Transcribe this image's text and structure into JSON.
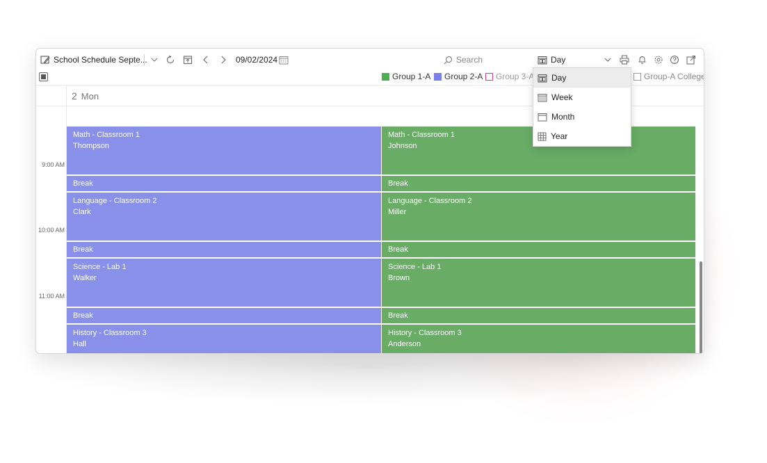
{
  "toolbar": {
    "title": "School Schedule Septe...",
    "date": "09/02/2024",
    "search_placeholder": "Search",
    "view_selected": "Day"
  },
  "legend": [
    {
      "label": "Group 1-A",
      "color": "#4caf50",
      "filled": true
    },
    {
      "label": "Group 2-A",
      "color": "#7b80e8",
      "filled": true
    },
    {
      "label": "Group 3-A",
      "color": "#e0407a",
      "filled": false
    },
    {
      "label": "Group-A College",
      "color": "#66cc44",
      "filled": false
    }
  ],
  "day_header": {
    "num": "2",
    "weekday": "Mon"
  },
  "time_labels": [
    "9:00 AM",
    "10:00 AM",
    "11:00 AM"
  ],
  "columns": [
    {
      "color": "#8890ea",
      "events": [
        {
          "title": "Math - Classroom 1",
          "teacher": "Thompson"
        },
        {
          "title": "Break",
          "teacher": ""
        },
        {
          "title": "Language - Classroom 2",
          "teacher": "Clark"
        },
        {
          "title": "Break",
          "teacher": ""
        },
        {
          "title": "Science - Lab 1",
          "teacher": "Walker"
        },
        {
          "title": "Break",
          "teacher": ""
        },
        {
          "title": "History - Classroom 3",
          "teacher": "Hall"
        }
      ]
    },
    {
      "color": "#68ac66",
      "events": [
        {
          "title": "Math - Classroom 1",
          "teacher": "Johnson"
        },
        {
          "title": "Break",
          "teacher": ""
        },
        {
          "title": "Language - Classroom 2",
          "teacher": "Miller"
        },
        {
          "title": "Break",
          "teacher": ""
        },
        {
          "title": "Science - Lab 1",
          "teacher": "Brown"
        },
        {
          "title": "Break",
          "teacher": ""
        },
        {
          "title": "History - Classroom 3",
          "teacher": "Anderson"
        }
      ]
    }
  ],
  "view_menu": [
    {
      "label": "Day",
      "icon": "day-view-icon",
      "active": true
    },
    {
      "label": "Week",
      "icon": "week-view-icon",
      "active": false
    },
    {
      "label": "Month",
      "icon": "month-view-icon",
      "active": false
    },
    {
      "label": "Year",
      "icon": "year-view-icon",
      "active": false
    }
  ]
}
